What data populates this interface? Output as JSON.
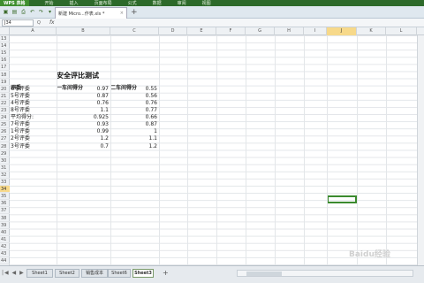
{
  "menubar": {
    "app": "WPS 表格",
    "items": [
      "开始",
      "插入",
      "页面布局",
      "公式",
      "数据",
      "审阅",
      "视图"
    ]
  },
  "toolbar": {
    "doc_tab": "新建 Micro...作表.xls *",
    "close": "×",
    "new_tab": "+"
  },
  "formula": {
    "namebox": "J34",
    "fx": "fx",
    "q": "Q"
  },
  "columns": [
    "A",
    "B",
    "C",
    "D",
    "E",
    "F",
    "G",
    "H",
    "I",
    "J",
    "K",
    "L"
  ],
  "active_column": "J",
  "rows": [
    "13",
    "14",
    "15",
    "16",
    "17",
    "18",
    "19",
    "20",
    "21",
    "22",
    "23",
    "24",
    "25",
    "26",
    "27",
    "28",
    "29",
    "30",
    "31",
    "32",
    "33",
    "34",
    "35",
    "36",
    "37",
    "38",
    "39",
    "40",
    "41",
    "42",
    "43",
    "44"
  ],
  "active_row": "34",
  "sheet": {
    "title": "安全评比测试",
    "header_a": "评委",
    "header_b": "一车间得分",
    "header_c": "二车间得分",
    "records": [
      {
        "judge": "6号评委",
        "b": "0.97",
        "c": "0.55"
      },
      {
        "judge": "5号评委",
        "b": "0.87",
        "c": "0.56"
      },
      {
        "judge": "4号评委",
        "b": "0.76",
        "c": "0.76"
      },
      {
        "judge": "8号评委",
        "b": "1.1",
        "c": "0.77"
      },
      {
        "judge": "平均得分:",
        "b": "0.925",
        "c": "0.66"
      },
      {
        "judge": "7号评委",
        "b": "0.93",
        "c": "0.87"
      },
      {
        "judge": "1号评委",
        "b": "0.99",
        "c": "1"
      },
      {
        "judge": "2号评委",
        "b": "1.2",
        "c": "1.1"
      },
      {
        "judge": "3号评委",
        "b": "0.7",
        "c": "1.2"
      }
    ]
  },
  "sheet_tabs": [
    "Sheet1",
    "Sheet2",
    "销售成本",
    "Sheet6",
    "Sheet3"
  ],
  "active_sheet": "Sheet3",
  "add_sheet": "+",
  "watermark": "Baidu经验"
}
